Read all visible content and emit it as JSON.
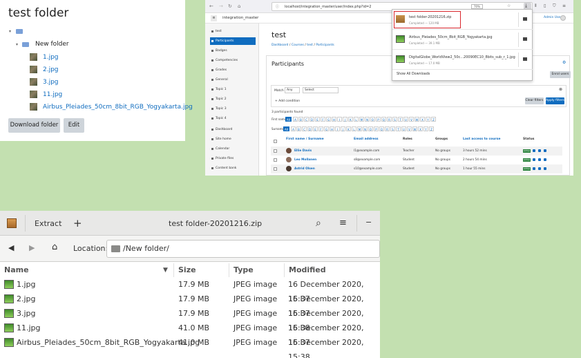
{
  "folder": {
    "title": "test folder",
    "subfolder": "New folder",
    "files": [
      "1.jpg",
      "2.jpg",
      "3.jpg",
      "11.jpg",
      "Airbus_Pleiades_50cm_8bit_RGB_Yogyakarta.jpg"
    ],
    "download_label": "Download folder",
    "edit_label": "Edit"
  },
  "browser": {
    "url": "localhost/integration_master/user/index.php?id=2",
    "zoom": "70%",
    "site_name": "integration_master",
    "user_label": "Admin User",
    "sidebar": [
      "test",
      "Participants",
      "Badges",
      "Competencies",
      "Grades",
      "General",
      "Topic 1",
      "Topic 2",
      "Topic 3",
      "Topic 4",
      "Dashboard",
      "Site home",
      "Calendar",
      "Private files",
      "Content bank"
    ],
    "course_title": "test",
    "breadcrumb": [
      "Dashboard",
      "Courses",
      "test",
      "Participants"
    ],
    "page_heading": "Participants",
    "enrol_label": "Enrol users",
    "match_label": "Match",
    "match_value": "Any",
    "select_value": "Select",
    "add_condition": "Add condition",
    "clear_filters": "Clear filters",
    "apply_filters": "Apply filters",
    "found_text": "3 participants found",
    "first_name_label": "First name",
    "surname_label": "Surname",
    "all_label": "All",
    "letters": [
      "A",
      "B",
      "C",
      "D",
      "E",
      "F",
      "G",
      "H",
      "I",
      "J",
      "K",
      "L",
      "M",
      "N",
      "O",
      "P",
      "Q",
      "R",
      "S",
      "T",
      "U",
      "V",
      "W",
      "X",
      "Y",
      "Z"
    ],
    "columns": [
      "First name / Surname",
      "Email address",
      "Roles",
      "Groups",
      "Last access to course",
      "Status"
    ],
    "rows": [
      {
        "name": "Ellie Davis",
        "email": "l1@example.com",
        "role": "Teacher",
        "groups": "No groups",
        "access": "3 hours 52 mins",
        "status": "Active"
      },
      {
        "name": "Leo Mollanen",
        "email": "s8@example.com",
        "role": "Student",
        "groups": "No groups",
        "access": "2 hours 54 mins",
        "status": "Active"
      },
      {
        "name": "Astrid Olsen",
        "email": "s10@example.com",
        "role": "Student",
        "groups": "No groups",
        "access": "1 hour 55 mins",
        "status": "Active"
      }
    ],
    "downloads": [
      {
        "name": "test folder-20201216.zip",
        "status": "Completed — 120 MB"
      },
      {
        "name": "Airbus_Pleiades_50cm_8bit_RGB_Yogyakarta.jpg",
        "status": "Completed — 39.1 MB"
      },
      {
        "name": "DigitalGlobe_WorldView2_50c...20090EC10_8bits_sub_r_1.jpg",
        "status": "Completed — 17.0 MB"
      }
    ],
    "show_all": "Show All Downloads",
    "colors": {
      "primary": "#0f6cbf",
      "highlight": "#d9262c"
    }
  },
  "archive": {
    "extract_label": "Extract",
    "title": "test folder-20201216.zip",
    "location_label": "Location:",
    "location_value": "/New folder/",
    "columns": [
      "Name",
      "Size",
      "Type",
      "Modified"
    ],
    "rows": [
      {
        "name": "1.jpg",
        "size": "17.9 MB",
        "type": "JPEG image",
        "modified": "16 December 2020, 15:37"
      },
      {
        "name": "2.jpg",
        "size": "17.9 MB",
        "type": "JPEG image",
        "modified": "16 December 2020, 15:37"
      },
      {
        "name": "3.jpg",
        "size": "17.9 MB",
        "type": "JPEG image",
        "modified": "16 December 2020, 15:38"
      },
      {
        "name": "11.jpg",
        "size": "41.0 MB",
        "type": "JPEG image",
        "modified": "16 December 2020, 15:37"
      },
      {
        "name": "Airbus_Pleiades_50cm_8bit_RGB_Yogyakarta.jpg",
        "size": "41.0 MB",
        "type": "JPEG image",
        "modified": "16 December 2020, 15:38"
      }
    ]
  }
}
